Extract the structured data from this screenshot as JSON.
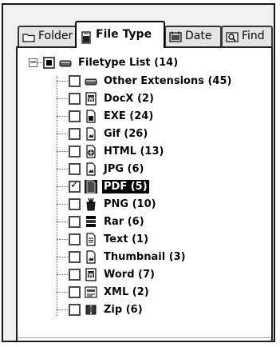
{
  "tabs": [
    {
      "label": "Folder",
      "icon": "folder-icon",
      "active": false
    },
    {
      "label": "File Type",
      "icon": "file-type-icon",
      "active": true
    },
    {
      "label": "Date",
      "icon": "date-icon",
      "active": false
    },
    {
      "label": "Find",
      "icon": "find-icon",
      "active": false
    }
  ],
  "tree": {
    "expander": "−",
    "root": {
      "label": "Filetype List (14)",
      "icon": "drive-icon",
      "check_state": "partial"
    },
    "items": [
      {
        "label": "Other Extensions (45)",
        "icon": "drive-icon",
        "checked": false,
        "selected": false
      },
      {
        "label": "DocX (2)",
        "icon": "word-doc-icon",
        "checked": false,
        "selected": false
      },
      {
        "label": "EXE (24)",
        "icon": "exe-file-icon",
        "checked": false,
        "selected": false
      },
      {
        "label": "Gif (26)",
        "icon": "image-file-icon",
        "checked": false,
        "selected": false
      },
      {
        "label": "HTML (13)",
        "icon": "html-file-icon",
        "checked": false,
        "selected": false
      },
      {
        "label": "JPG (6)",
        "icon": "image-file-icon",
        "checked": false,
        "selected": false
      },
      {
        "label": "PDF (5)",
        "icon": "pdf-file-icon",
        "checked": true,
        "selected": true
      },
      {
        "label": "PNG (10)",
        "icon": "paint-icon",
        "checked": false,
        "selected": false
      },
      {
        "label": "Rar (6)",
        "icon": "archive-icon",
        "checked": false,
        "selected": false
      },
      {
        "label": "Text (1)",
        "icon": "text-file-icon",
        "checked": false,
        "selected": false
      },
      {
        "label": "Thumbnail (3)",
        "icon": "image-file-icon",
        "checked": false,
        "selected": false
      },
      {
        "label": "Word (7)",
        "icon": "word-doc-icon",
        "checked": false,
        "selected": false
      },
      {
        "label": "XML (2)",
        "icon": "xml-file-icon",
        "checked": false,
        "selected": false
      },
      {
        "label": "Zip (6)",
        "icon": "zip-file-icon",
        "checked": false,
        "selected": false
      }
    ]
  }
}
